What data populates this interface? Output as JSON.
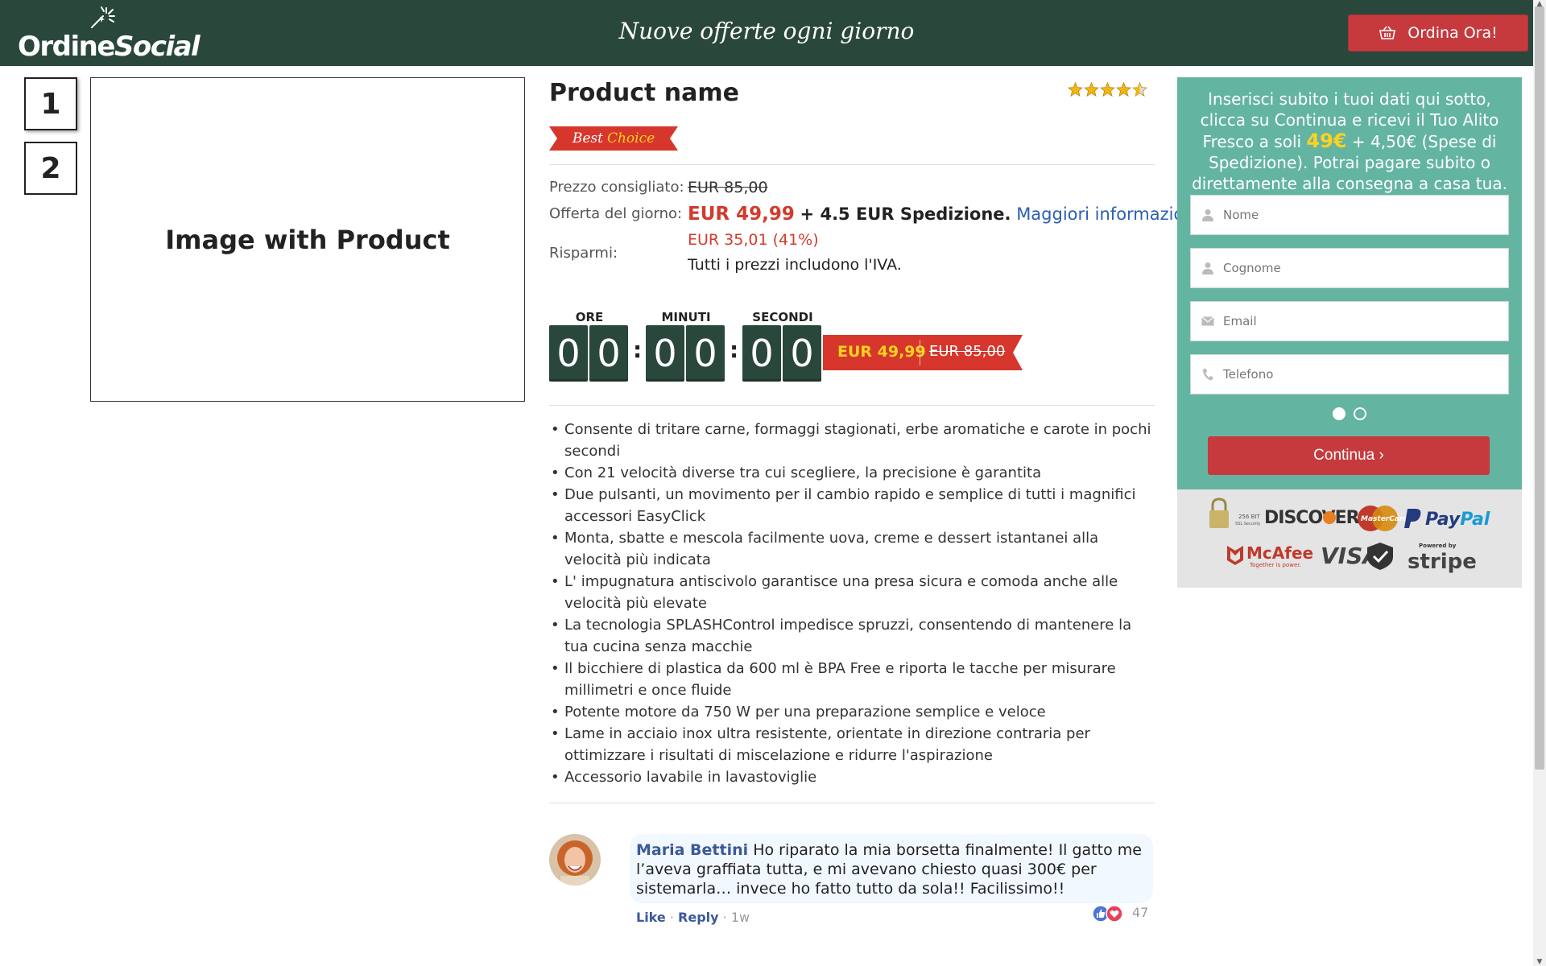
{
  "header": {
    "logo_part1": "Ordine",
    "logo_part2": "Social",
    "tagline": "Nuove offerte ogni giorno",
    "order_button": "Ordina Ora!"
  },
  "gallery": {
    "thumbnails": [
      "1",
      "2"
    ],
    "main_image_text": "Image with Product"
  },
  "product": {
    "title": "Product name",
    "rating": 4.5,
    "badge_part1": "Best",
    "badge_part2": "Choice",
    "list_price_label": "Prezzo consigliato:",
    "list_price": "EUR 85,00",
    "offer_label": "Offerta del giorno:",
    "offer_price": "EUR 49,99",
    "offer_shipping": "+ 4.5 EUR Spedizione.",
    "more_info_link": "Maggiori informazioni",
    "savings_label": "Risparmi:",
    "savings_value": "EUR 35,01 (41%)",
    "vat_note": "Tutti i prezzi includono l'IVA."
  },
  "countdown": {
    "hours_label": "ORE",
    "minutes_label": "MINUTI",
    "seconds_label": "SECONDI",
    "digits": [
      "0",
      "0",
      "0",
      "0",
      "0",
      "0"
    ],
    "ribbon_price": "EUR 49,99",
    "ribbon_old_price": "EUR 85,00"
  },
  "features": [
    "Consente di tritare carne, formaggi stagionati, erbe aromatiche e carote in pochi secondi",
    "Con 21 velocità diverse tra cui scegliere, la precisione è garantita",
    "Due pulsanti, un movimento per il cambio rapido e semplice di tutti i magnifici accessori EasyClick",
    "Monta, sbatte e mescola facilmente uova, creme e dessert istantanei alla velocità più indicata",
    "L' impugnatura antiscivolo garantisce una presa sicura e comoda anche alle velocità più elevate",
    "La tecnologia SPLASHControl impedisce spruzzi, consentendo di mantenere la tua cucina senza macchie",
    "Il bicchiere di plastica da 600 ml è BPA Free e riporta le tacche per misurare millimetri e once fluide",
    "Potente motore da 750 W per una preparazione semplice e veloce",
    "Lame in acciaio inox ultra resistente, orientate in direzione contraria per ottimizzare i risultati di miscelazione e ridurre l'aspirazione",
    "Accessorio lavabile in lavastoviglie"
  ],
  "comment": {
    "author": "Maria Bettini",
    "text": "Ho riparato la mia borsetta finalmente! Il gatto me l’aveva graffiata tutta, e mi avevano chiesto quasi 300€ per sistemarla… invece ho fatto tutto da sola!! Facilissimo!!",
    "like": "Like",
    "reply": "Reply",
    "time": "1w",
    "reaction_count": "47"
  },
  "form": {
    "intro_1": "Inserisci subito i tuoi dati qui sotto, clicca su Continua e ricevi il Tuo Alito Fresco a soli",
    "intro_price": "49€",
    "intro_2": "+ 4,50€ (Spese di Spedizione). Potrai pagare subito o direttamente alla consegna a casa tua.",
    "name_placeholder": "Nome",
    "surname_placeholder": "Cognome",
    "email_placeholder": "Email",
    "phone_placeholder": "Telefono",
    "continue_button": "Continua ›"
  },
  "payment_logos": {
    "ssl_line1": "256 BIT",
    "ssl_line2": "SSL Security",
    "discover": "DISCOVER",
    "mastercard": "MasterCard",
    "paypal_1": "Pay",
    "paypal_2": "Pal",
    "mcafee": "McAfee",
    "mcafee_sub": "Together is power.",
    "visa": "VISA",
    "stripe_top": "Powered by",
    "stripe": "stripe"
  },
  "colors": {
    "header_bg": "#2a473c",
    "accent_red": "#c63a3d",
    "form_bg": "#64b4a2",
    "highlight_yellow": "#ffd21f",
    "link_blue": "#2a5fb3"
  }
}
